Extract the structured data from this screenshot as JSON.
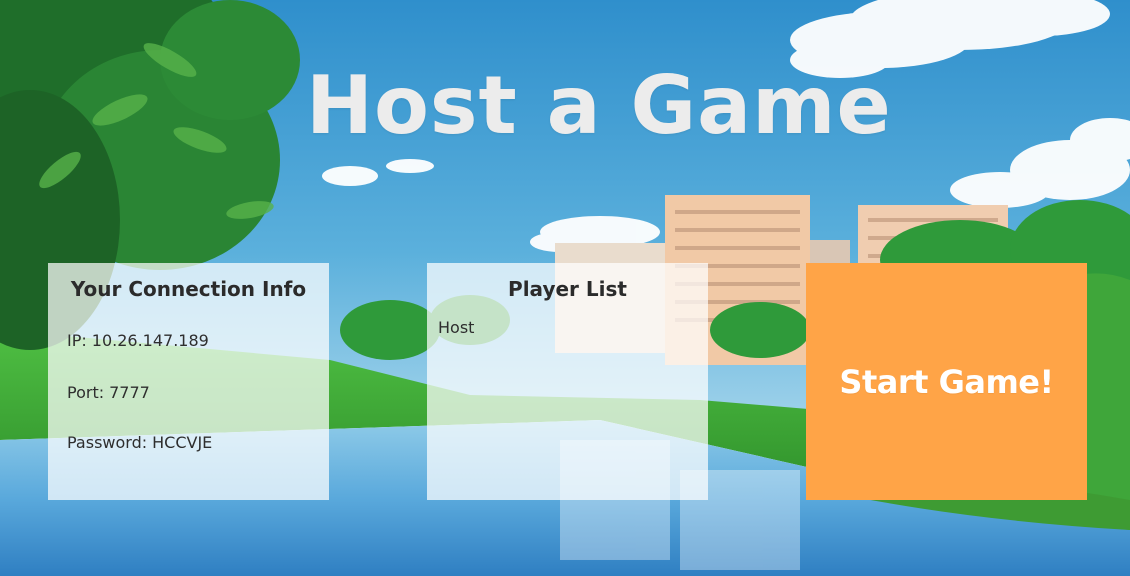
{
  "title": "Host a Game",
  "connection_panel": {
    "heading": "Your Connection Info",
    "ip_label": "IP:",
    "ip_value": "10.26.147.189",
    "port_label": "Port:",
    "port_value": "7777",
    "password_label": "Password:",
    "password_value": "HCCVJE"
  },
  "player_panel": {
    "heading": "Player List",
    "players": [
      "Host"
    ]
  },
  "start_button": {
    "label": "Start Game!"
  },
  "colors": {
    "start_button": "#ffa447",
    "sky": "#3a9bd2",
    "title_text": "#ececec"
  }
}
